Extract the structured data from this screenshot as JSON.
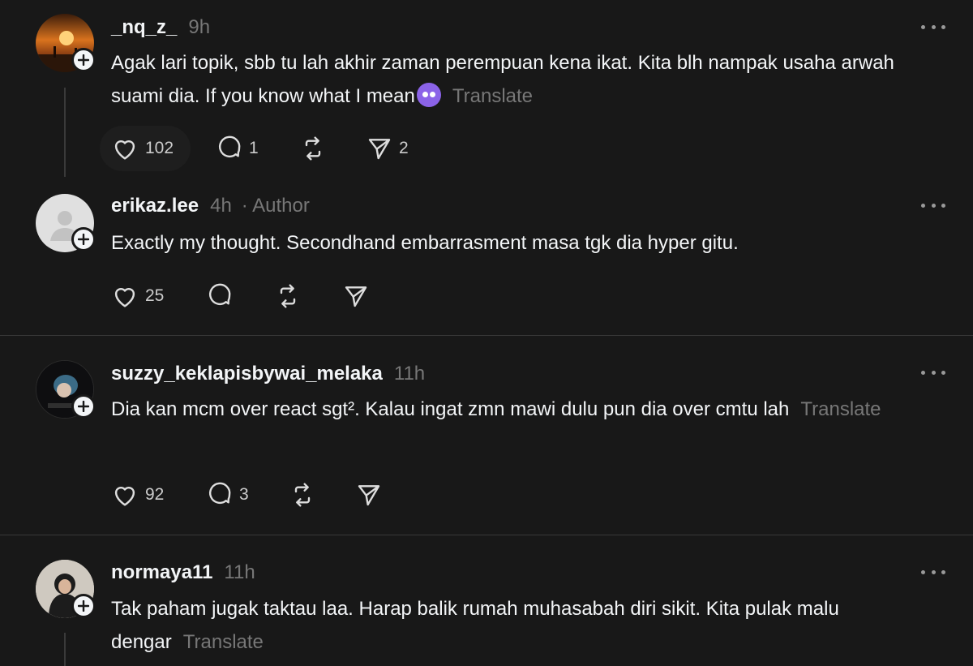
{
  "posts": [
    {
      "username": "_nq_z_",
      "time": "9h",
      "text": "Agak lari topik, sbb tu lah akhir zaman perempuan kena ikat. Kita blh nampak usaha arwah suami dia. If you know what I mean",
      "emoji_icon": "pleading-face-emoji",
      "translate": "Translate",
      "likes": "102",
      "replies": "1",
      "shares": "2"
    },
    {
      "username": "erikaz.lee",
      "time": "4h",
      "author_label": "· Author",
      "text": "Exactly my thought. Secondhand embarrasment masa tgk dia hyper gitu.",
      "likes": "25"
    },
    {
      "username": "suzzy_keklapisbywai_melaka",
      "time": "11h",
      "text": "Dia kan mcm over react sgt². Kalau ingat zmn mawi dulu pun dia over cmtu lah",
      "translate": "Translate",
      "likes": "92",
      "replies": "3"
    },
    {
      "username": "normaya11",
      "time": "11h",
      "text": "Tak paham jugak taktau laa. Harap balik rumah muhasabah diri sikit. Kita pulak malu dengar",
      "translate": "Translate"
    }
  ],
  "colors": {
    "background": "#181818",
    "text": "#f3f5f7",
    "muted": "#777777",
    "divider": "#383838"
  }
}
